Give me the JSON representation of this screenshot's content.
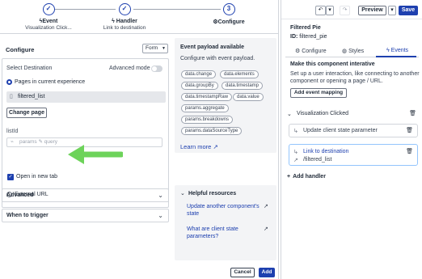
{
  "steps": [
    {
      "number": "✓",
      "title": "Event",
      "subtitle": "Visualization Click..."
    },
    {
      "number": "✓",
      "title": "Handler",
      "subtitle": "Link to destination"
    },
    {
      "number": "3",
      "title": "Configure",
      "subtitle": ""
    }
  ],
  "configure": {
    "title": "Configure",
    "form_select": "Form",
    "select_destination": "Select Destination",
    "advanced_mode": "Advanced mode",
    "option_pages": "Pages in current experience",
    "page_value": "filtered_list",
    "change_page": "Change page",
    "listid_label": "listId",
    "listid_placeholder": "params ✎ query",
    "open_new_tab": "Open in new tab",
    "option_external": "External URL",
    "advanced": "Advanced",
    "when_to_trigger": "When to trigger"
  },
  "payload": {
    "title": "Event payload available",
    "subtitle": "Configure with event payload.",
    "chips": [
      "data.change",
      "data.elements",
      "data.groupBy",
      "data.timestamp",
      "data.timestampRaw",
      "data.value",
      "params.aggregate",
      "params.breakdowns",
      "params.dataSourceType"
    ],
    "learn_more": "Learn more"
  },
  "helpful": {
    "title": "Helpful resources",
    "links": [
      "Update another component's state",
      "What are client state parameters?"
    ]
  },
  "footer": {
    "cancel": "Cancel",
    "add": "Add"
  },
  "panel": {
    "preview": "Preview",
    "save": "Save",
    "component_name": "Filtered Pie",
    "id_label": "ID:",
    "id_value": "filtered_pie",
    "tabs": [
      "Configure",
      "Styles",
      "Events"
    ],
    "active_tab": "Events",
    "events_title": "Make this component interative",
    "events_desc": "Set up a user interaction, like connecting to another component or opening a page / URL.",
    "add_event_mapping": "Add event mapping",
    "event_name": "Visualization Clicked",
    "action1": "Update client state parameter",
    "action2": "Link to destination",
    "action2_sub": "/filtered_list",
    "add_handler": "Add handler"
  },
  "colors": {
    "accent": "#1e40af",
    "arrow": "#6dd35a"
  }
}
